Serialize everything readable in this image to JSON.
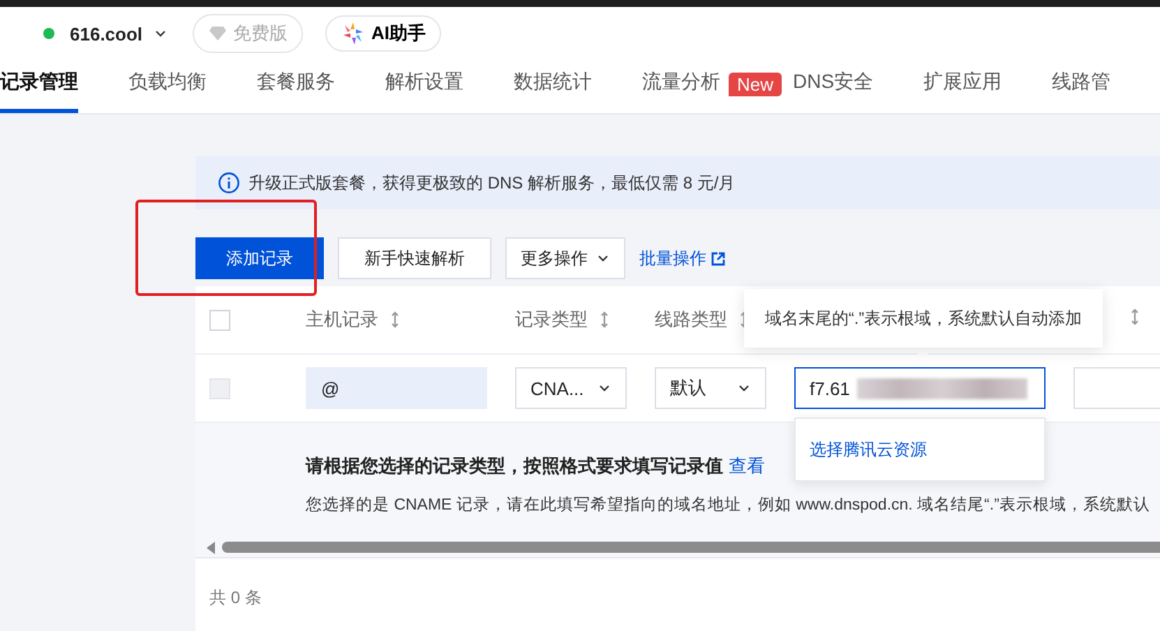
{
  "domain": {
    "name": "616.cool"
  },
  "plan_badge": "免费版",
  "ai_button": "AI助手",
  "tabs": [
    {
      "label": "记录管理",
      "selected": true
    },
    {
      "label": "负载均衡",
      "selected": false
    },
    {
      "label": "套餐服务",
      "selected": false
    },
    {
      "label": "解析设置",
      "selected": false
    },
    {
      "label": "数据统计",
      "selected": false
    },
    {
      "label": "流量分析",
      "selected": false,
      "badge": "New"
    },
    {
      "label": "DNS安全",
      "selected": false
    },
    {
      "label": "扩展应用",
      "selected": false
    },
    {
      "label": "线路管",
      "selected": false
    }
  ],
  "notice": "升级正式版套餐，获得更极致的 DNS 解析服务，最低仅需 8 元/月",
  "actions": [
    {
      "kind": "primary",
      "label": "添加记录"
    },
    {
      "kind": "default",
      "label": "新手快速解析"
    },
    {
      "kind": "dropdown",
      "label": "更多操作"
    },
    {
      "kind": "link",
      "label": "批量操作"
    }
  ],
  "table": {
    "select_all": {
      "checked": false
    },
    "columns": [
      {
        "label": "主机记录"
      },
      {
        "label": "记录类型"
      },
      {
        "label": "线路类型"
      }
    ],
    "edit_row": {
      "checkbox": {
        "checked": false,
        "disabled": true
      },
      "host": "@",
      "type": "CNA...",
      "line": "默认",
      "value": "f7.61"
    }
  },
  "tooltip": "域名末尾的“.”表示根域，系统默认自动添加",
  "suggestion": "选择腾讯云资源",
  "hint": {
    "title": "请根据您选择的记录类型，按照格式要求填写记录值",
    "link": "查看",
    "detail": "您选择的是 CNAME 记录，请在此填写希望指向的域名地址，例如 www.dnspod.cn. 域名结尾“.”表示根域，系统默认"
  },
  "total": "共 0 条"
}
